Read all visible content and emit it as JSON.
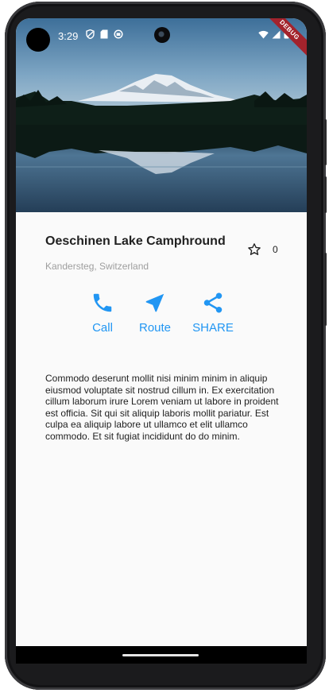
{
  "status_bar": {
    "time": "3:29",
    "left_icons": [
      "shield-icon",
      "sd-card-icon",
      "circle-status-icon"
    ],
    "right_icons": [
      "wifi-icon",
      "signal-icon",
      "battery-icon"
    ],
    "debug_banner": "DEBUG"
  },
  "hero": {
    "image": "mountain-lake-photo"
  },
  "place": {
    "title": "Oeschinen Lake Camphround",
    "subtitle": "Kandersteg, Switzerland",
    "favorite_count": "0"
  },
  "actions": [
    {
      "label": "Call",
      "icon": "phone-icon"
    },
    {
      "label": "Route",
      "icon": "navigation-icon"
    },
    {
      "label": "SHARE",
      "icon": "share-icon"
    }
  ],
  "description": "Commodo deserunt mollit nisi minim minim in aliquip eiusmod voluptate sit nostrud cillum in. Ex exercitation cillum laborum irure Lorem veniam ut labore in proident est officia. Sit qui sit aliquip laboris mollit pariatur. Est culpa ea aliquip labore ut ullamco et elit ullamco commodo. Et sit fugiat incididunt do do minim.",
  "colors": {
    "accent": "#2196f3",
    "title": "#212121",
    "subtitle": "#9e9e9e",
    "background": "#fafafa",
    "debug_ribbon": "#a3232c"
  }
}
